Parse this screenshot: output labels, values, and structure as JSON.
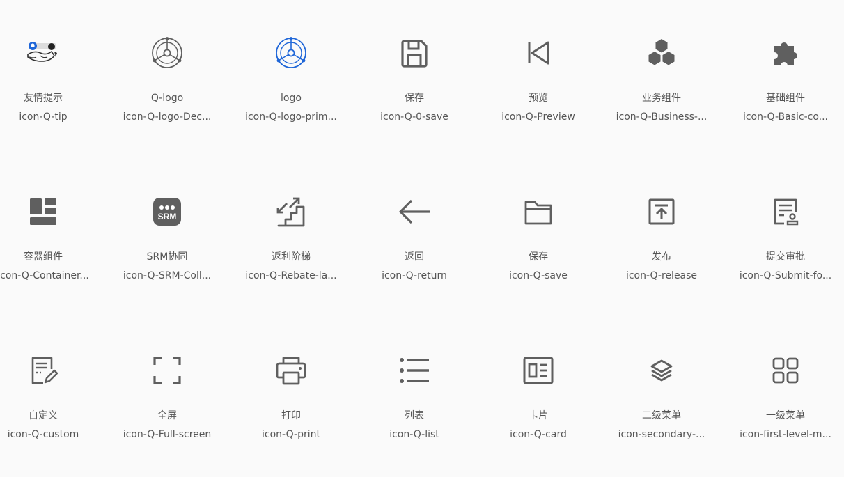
{
  "colors": {
    "icon_gray": "#5f5f5f",
    "accent_blue": "#1f66d8",
    "text": "#555555",
    "background": "#fafafa"
  },
  "icons": [
    {
      "name": "友情提示",
      "code": "icon-Q-tip",
      "icon": "tip-icon"
    },
    {
      "name": "Q-logo",
      "code": "icon-Q-logo-Dec...",
      "icon": "q-logo-icon"
    },
    {
      "name": "logo",
      "code": "icon-Q-logo-prim...",
      "icon": "q-logo-primary-icon"
    },
    {
      "name": "保存",
      "code": "icon-Q-0-save",
      "icon": "floppy-save-icon"
    },
    {
      "name": "预览",
      "code": "icon-Q-Preview",
      "icon": "preview-skip-back-icon"
    },
    {
      "name": "业务组件",
      "code": "icon-Q-Business-...",
      "icon": "business-cubes-icon"
    },
    {
      "name": "基础组件",
      "code": "icon-Q-Basic-co...",
      "icon": "puzzle-icon"
    },
    {
      "name": "容器组件",
      "code": "icon-Q-Container...",
      "icon": "container-layout-icon"
    },
    {
      "name": "SRM协同",
      "code": "icon-Q-SRM-Coll...",
      "icon": "srm-icon"
    },
    {
      "name": "返利阶梯",
      "code": "icon-Q-Rebate-la...",
      "icon": "rebate-ladder-icon"
    },
    {
      "name": "返回",
      "code": "icon-Q-return",
      "icon": "arrow-left-icon"
    },
    {
      "name": "保存",
      "code": "icon-Q-save",
      "icon": "folder-icon"
    },
    {
      "name": "发布",
      "code": "icon-Q-release",
      "icon": "release-upload-icon"
    },
    {
      "name": "提交审批",
      "code": "icon-Q-Submit-fo...",
      "icon": "submit-approval-icon"
    },
    {
      "name": "自定义",
      "code": "icon-Q-custom",
      "icon": "custom-edit-icon"
    },
    {
      "name": "全屏",
      "code": "icon-Q-Full-screen",
      "icon": "fullscreen-icon"
    },
    {
      "name": "打印",
      "code": "icon-Q-print",
      "icon": "printer-icon"
    },
    {
      "name": "列表",
      "code": "icon-Q-list",
      "icon": "list-icon"
    },
    {
      "name": "卡片",
      "code": "icon-Q-card",
      "icon": "card-icon"
    },
    {
      "name": "二级菜单",
      "code": "icon-secondary-...",
      "icon": "layers-icon"
    },
    {
      "name": "一级菜单",
      "code": "icon-first-level-m...",
      "icon": "grid-four-icon"
    }
  ]
}
